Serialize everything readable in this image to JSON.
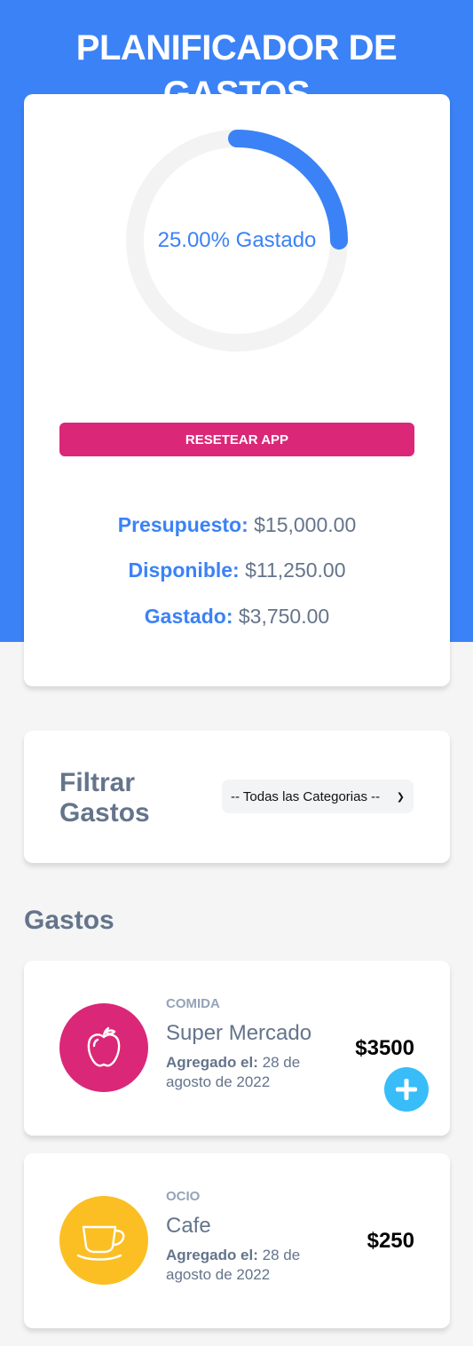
{
  "header": {
    "title": "PLANIFICADOR DE GASTOS"
  },
  "budget": {
    "percent_text": "25.00% Gastado",
    "percent_spent": 25,
    "reset_label": "RESETEAR APP",
    "budget_label": "Presupuesto:",
    "budget_value": "$15,000.00",
    "available_label": "Disponible:",
    "available_value": "$11,250.00",
    "spent_label": "Gastado:",
    "spent_value": "$3,750.00"
  },
  "filter": {
    "title": "Filtrar Gastos",
    "selected": "-- Todas las Categorias --"
  },
  "expenses": {
    "title": "Gastos",
    "items": [
      {
        "category": "COMIDA",
        "name": "Super Mercado",
        "date_label": "Agregado el:",
        "date_value": "28 de agosto de 2022",
        "amount": "$3500",
        "icon": "apple-icon",
        "color": "#db2777"
      },
      {
        "category": "OCIO",
        "name": "Cafe",
        "date_label": "Agregado el:",
        "date_value": "28 de agosto de 2022",
        "amount": "$250",
        "icon": "coffee-cup-icon",
        "color": "#fbbf24"
      }
    ]
  },
  "colors": {
    "primary": "#3b82f6",
    "accent": "#db2777",
    "add_button": "#38bdf8"
  }
}
